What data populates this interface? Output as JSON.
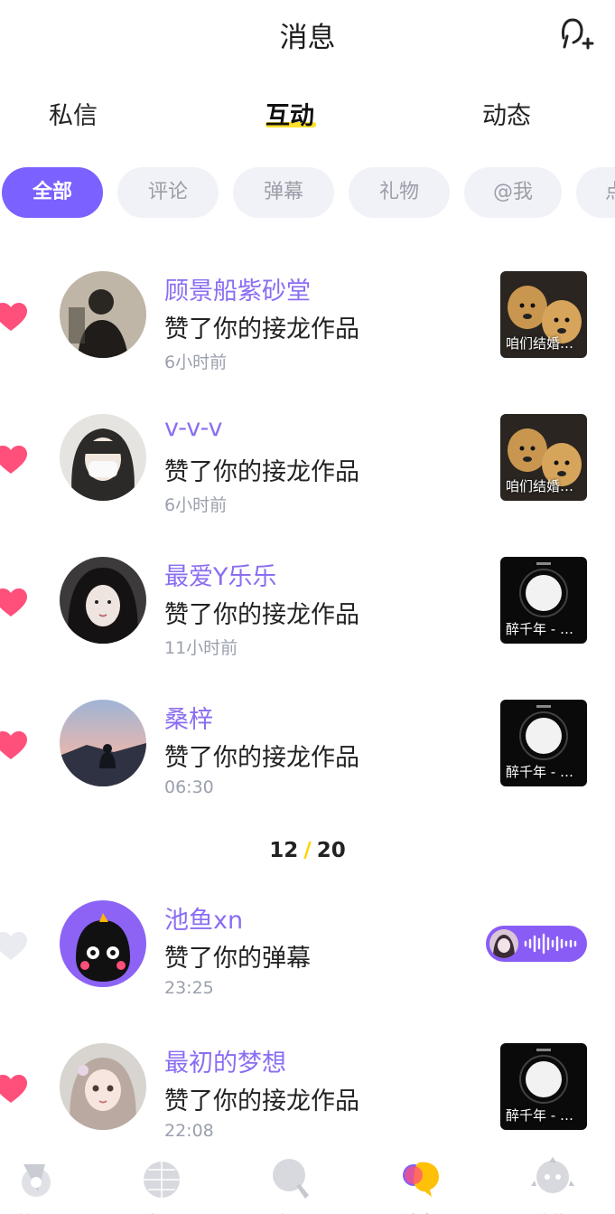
{
  "header": {
    "title": "消息"
  },
  "tabs": [
    {
      "label": "私信"
    },
    {
      "label": "互动"
    },
    {
      "label": "动态"
    }
  ],
  "chips": [
    {
      "label": "全部"
    },
    {
      "label": "评论"
    },
    {
      "label": "弹幕"
    },
    {
      "label": "礼物"
    },
    {
      "label": "@我"
    },
    {
      "label": "点"
    }
  ],
  "items": [
    {
      "name": "顾景船紫砂堂",
      "action": "赞了你的接龙作品",
      "time": "6小时前",
      "liked": true,
      "thumb_caption": "咱们结婚…"
    },
    {
      "name": "v-v-v",
      "action": "赞了你的接龙作品",
      "time": "6小时前",
      "liked": true,
      "thumb_caption": "咱们结婚…"
    },
    {
      "name": "最爱Y乐乐",
      "action": "赞了你的接龙作品",
      "time": "11小时前",
      "liked": true,
      "thumb_caption": "醉千年 - …"
    },
    {
      "name": "桑梓",
      "action": "赞了你的接龙作品",
      "time": "06:30",
      "liked": true,
      "thumb_caption": "醉千年 - …"
    },
    {
      "name": "池鱼xn",
      "action": "赞了你的弹幕",
      "time": "23:25",
      "liked": false
    },
    {
      "name": "最初的梦想",
      "action": "赞了你的接龙作品",
      "time": "22:08",
      "liked": true,
      "thumb_caption": "醉千年 - …"
    }
  ],
  "pager": {
    "current": "12",
    "separator": "/",
    "total": "20"
  },
  "colors": {
    "accent": "#7b61ff",
    "name": "#8b6df2",
    "heart": "#ff4f7b",
    "highlight": "#ffe02a"
  },
  "bottom_nav": [
    {
      "label": "首页",
      "icon": "home-icon"
    },
    {
      "label": "发现",
      "icon": "disco-ball-icon"
    },
    {
      "label": "点唱",
      "icon": "mic-icon"
    },
    {
      "label": "消息",
      "icon": "message-icon"
    },
    {
      "label": "我的",
      "icon": "profile-icon"
    }
  ]
}
